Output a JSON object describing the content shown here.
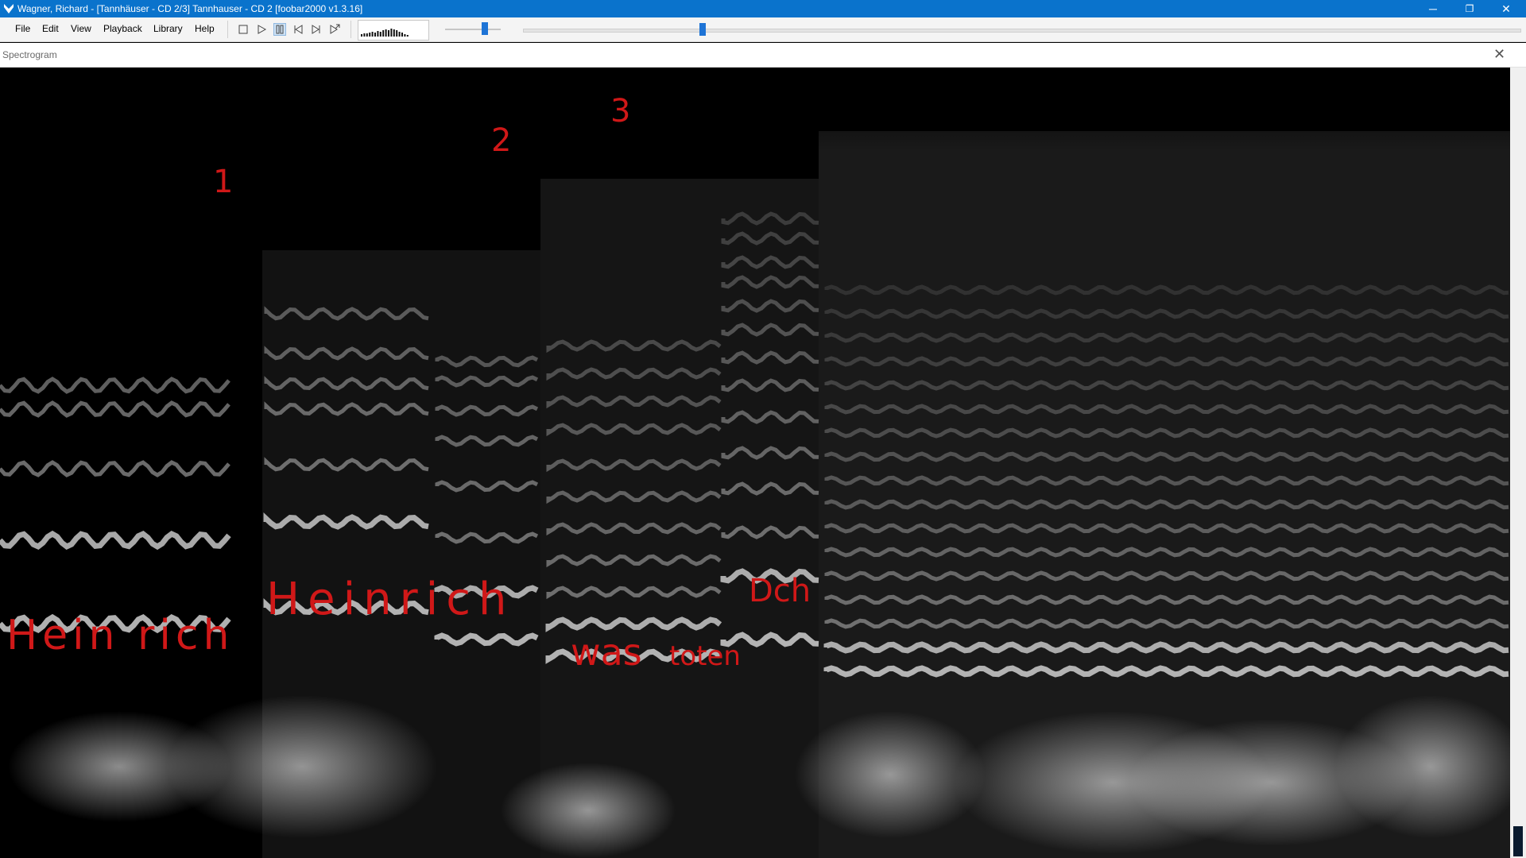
{
  "window": {
    "title": "Wagner, Richard - [Tannhäuser - CD 2/3] Tannhauser - CD 2  [foobar2000 v1.3.16]",
    "buttons": {
      "minimize": "─",
      "maximize": "❐",
      "close": "✕"
    }
  },
  "menu": [
    "File",
    "Edit",
    "View",
    "Playback",
    "Library",
    "Help"
  ],
  "toolbar": {
    "icons": [
      "stop-icon",
      "play-icon",
      "pause-icon",
      "previous-icon",
      "next-icon",
      "random-icon"
    ],
    "active": "pause-icon"
  },
  "volume_level": 0.72,
  "seek_position": 0.18,
  "panel": {
    "title": "Spectrogram",
    "close_glyph": "✕"
  },
  "annotations": {
    "marker_1": "1",
    "marker_2": "2",
    "marker_3": "3",
    "word_1": "Hein rich",
    "word_2": "Heinrich",
    "word_3": "was",
    "word_4": "toten",
    "word_5": "Dch"
  },
  "colors": {
    "accent": "#0a73cc",
    "annotation": "#d01818",
    "seek": "#1e74d6"
  }
}
